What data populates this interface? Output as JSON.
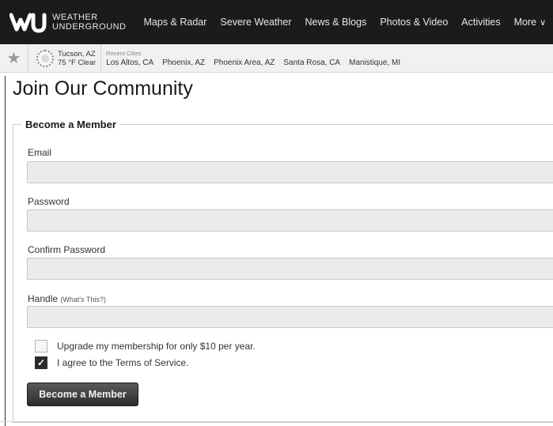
{
  "header": {
    "logo_line1": "WEATHER",
    "logo_line2": "UNDERGROUND",
    "nav": [
      "Maps & Radar",
      "Severe Weather",
      "News & Blogs",
      "Photos & Video",
      "Activities",
      "More"
    ],
    "more_icon": "chevron-down-icon"
  },
  "location_bar": {
    "favorite_icon": "star-icon",
    "current": {
      "city": "Tucson, AZ",
      "conditions": "75 °F Clear",
      "icon": "sun-icon"
    },
    "recent_label": "Recent Cities",
    "recent_cities": [
      "Los Altos, CA",
      "Phoenix, AZ",
      "Phoenix Area, AZ",
      "Santa Rosa, CA",
      "Manistique, MI"
    ]
  },
  "page": {
    "title": "Join Our Community"
  },
  "form": {
    "legend": "Become a Member",
    "email_label": "Email",
    "email_value": "",
    "password_label": "Password",
    "password_value": "",
    "confirm_label": "Confirm Password",
    "confirm_value": "",
    "handle_label": "Handle",
    "handle_help": "(What's This?)",
    "handle_value": "",
    "upgrade_label": "Upgrade my membership for only $10 per year.",
    "upgrade_checked": false,
    "terms_label": "I agree to the Terms of Service.",
    "terms_checked": true,
    "submit_label": "Become a Member"
  }
}
